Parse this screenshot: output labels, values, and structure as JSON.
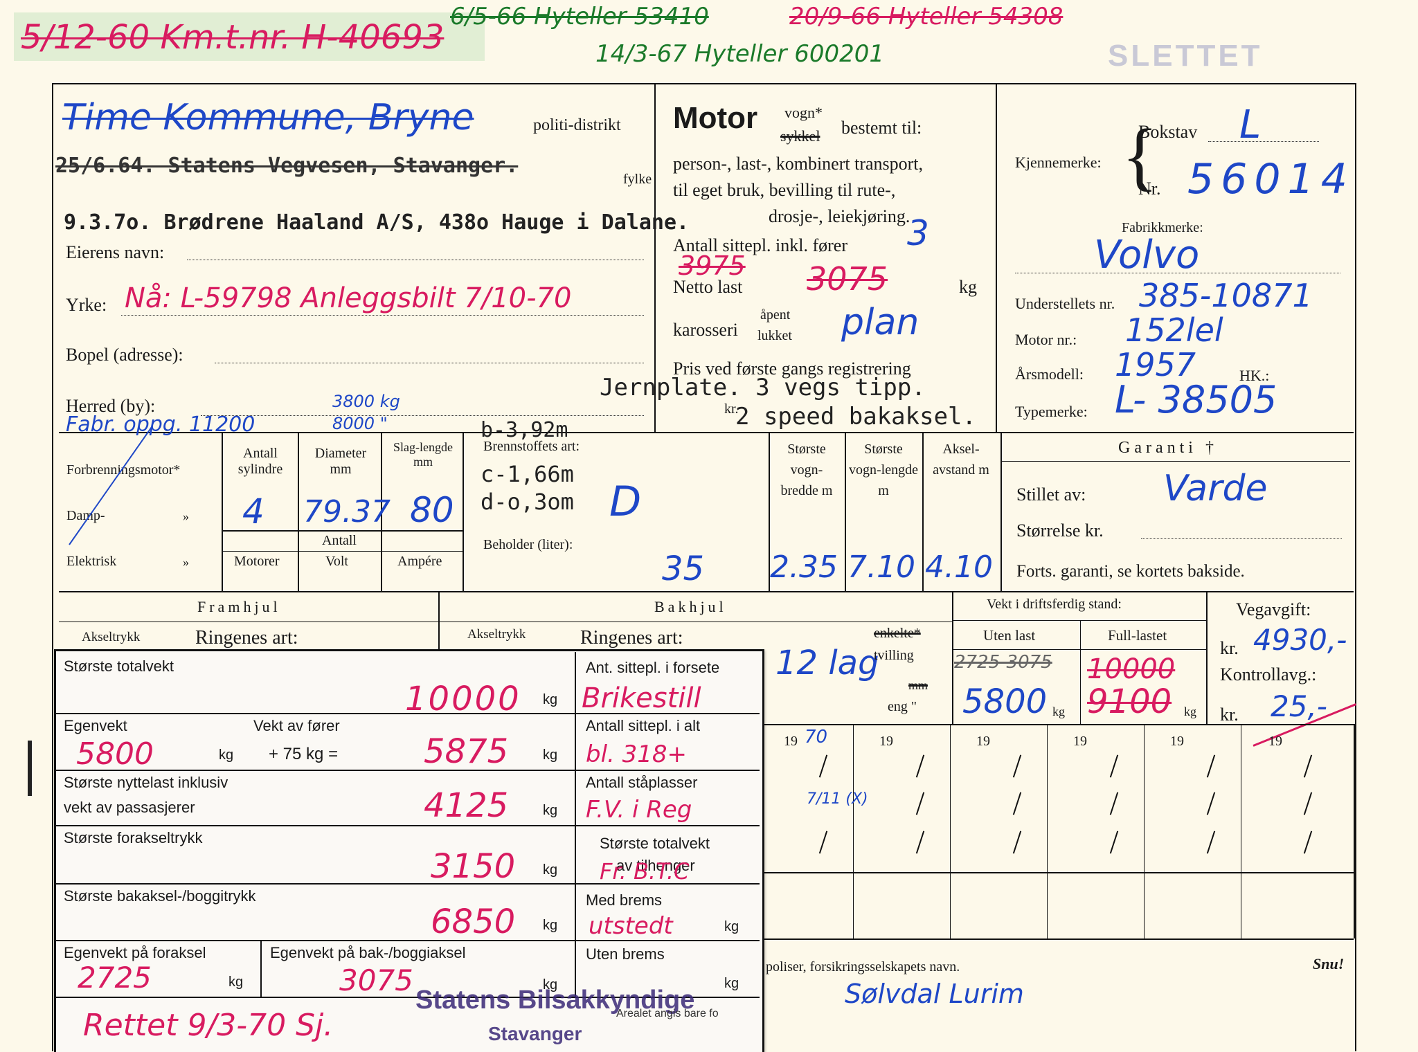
{
  "header": {
    "reg_line": "5/12-60 Km.t.nr. H-40693",
    "meter1": "6/5-66 Hyteller 53410",
    "meter2": "20/9-66 Hyteller 54308",
    "meter3": "14/3-67 Hyteller 600201",
    "stamp": "SLETTET"
  },
  "owner": {
    "district_label": "politi-distrikt",
    "struck_line1": "Time Kommune, Bryne",
    "struck_line2": "25/6.64. Statens Vegvesen, Stavanger.",
    "fylke_label": "fylke",
    "typed_owner": "9.3.7o. Brødrene Haaland A/S, 438o Hauge i Dalane.",
    "eier_label": "Eierens navn:",
    "yrke_label": "Yrke:",
    "yrke_value": "Nå: L-59798 Anleggsbilt 7/10-70",
    "bopel_label": "Bopel (adresse):",
    "herred_label": "Herred (by):",
    "fabr_note": "Fabr. oppg. 11200",
    "fabr_note2": "3800 kg",
    "fabr_note3": "8000 \""
  },
  "motor": {
    "title": "Motor",
    "vogn": "vogn*",
    "sykkel": "sykkel",
    "bestemt": "bestemt til:",
    "line1": "person-, last-, kombinert transport,",
    "line2": "til eget bruk, bevilling til rute-,",
    "line3": "drosje-, leiekjøring.",
    "sitteplasser_label": "Antall sittepl. inkl. fører",
    "sitteplasser_value": "3",
    "netto_label": "Netto last",
    "netto_struck": "3975",
    "netto_value": "3075",
    "kg": "kg",
    "karosseri_label": "karosseri",
    "apent": "åpent",
    "lukket": "lukket",
    "karosseri_value": "plan",
    "pris_label": "Pris ved første gangs registrering",
    "kr": "kr.",
    "typed_note1": "Jernplate. 3 vegs tipp.",
    "typed_note2": "2 speed bakaksel."
  },
  "ident": {
    "kjennemerke_label": "Kjennemerke:",
    "bokstav_label": "Bokstav",
    "bokstav_value": "L",
    "nr_label": "Nr.",
    "nr_value": "56014",
    "fabrikk_label": "Fabrikkmerke:",
    "fabrikk_value": "Volvo",
    "understell_label": "Understellets nr.",
    "understell_value": "385-10871",
    "motornr_label": "Motor nr.:",
    "motornr_value": "152lel",
    "arsmodell_label": "Årsmodell:",
    "arsmodell_value": "1957",
    "hk_label": "HK.:",
    "typemerke_label": "Typemerke:",
    "typemerke_value": "L- 38505"
  },
  "engine": {
    "forbrenning": "Forbrenningsmotor*",
    "damp": "Damp-",
    "elektrisk": "Elektrisk",
    "quote": "»",
    "sylindre_label": "Antall sylindre",
    "diameter_label": "Diameter mm",
    "slag_label": "Slag-lengde mm",
    "sylindre_value": "4",
    "diameter_value": "79.37",
    "slag_value": "80",
    "antall_label": "Antall",
    "motorer_label": "Motorer",
    "volt_label": "Volt",
    "ampere_label": "Ampére",
    "brennstoff_label": "Brennstoffets art:",
    "brennstoff_value": "D",
    "typed_b": "b-3,92m",
    "typed_c": "c-1,66m",
    "typed_d": "d-o,3om",
    "beholder_label": "Beholder (liter):",
    "beholder_value": "35"
  },
  "dims": {
    "bredde_label": "Største vogn-bredde m",
    "lengde_label": "Største vogn-lengde m",
    "aksel_label": "Aksel-avstand m",
    "bredde_value": "2.35",
    "lengde_value": "7.10",
    "aksel_value": "4.10"
  },
  "garanti": {
    "title": "Garanti †",
    "stillet_label": "Stillet av:",
    "stillet_value": "Varde",
    "storrelse_label": "Størrelse kr.",
    "forts": "Forts. garanti, se kortets bakside."
  },
  "wheels": {
    "framhjul": "Framhjul",
    "bakhjul": "Bakhjul",
    "akseltrykk1": "Akseltrykk",
    "ringenes1": "Ringenes art:",
    "akseltrykk2": "Akseltrykk",
    "ringenes2": "Ringenes art:",
    "lag_value": "12 lag",
    "enkelte": "enkelte*",
    "tvilling": "tvilling",
    "mm": "mm",
    "eng": "eng \""
  },
  "vekt": {
    "title": "Vekt i driftsferdig stand:",
    "uten_label": "Uten last",
    "full_label": "Full-lastet",
    "uten_struck": "2725-3075",
    "full_struck": "10000",
    "uten_value": "5800",
    "full_value": "9100",
    "kg": "kg"
  },
  "avgift": {
    "vegavgift_label": "Vegavgift:",
    "kr1": "kr.",
    "vegavgift_value": "4930,-",
    "kontroll_label": "Kontrollavg.:",
    "kr2": "kr.",
    "kontroll_value": "25,-"
  },
  "years": {
    "prefix": "19",
    "first_suffix": "70",
    "entry": "7/11 (X)"
  },
  "bottom": {
    "poliser": "poliser, forsikringsselskapets navn.",
    "forsikring_value": "Sølvdal Lurim",
    "snu": "Snu!"
  },
  "slip": {
    "totalvekt_label": "Største totalvekt",
    "totalvekt_value": "10000",
    "egenvekt_label": "Egenvekt",
    "egenvekt_value": "5800",
    "forer_label": "Vekt av fører",
    "plus75": "+ 75 kg =",
    "forer_value": "5875",
    "nyttelast_label1": "Største nyttelast inklusiv",
    "nyttelast_label2": "vekt av passasjerer",
    "nyttelast_value": "4125",
    "foraksel_label": "Største forakseltrykk",
    "foraksel_value": "3150",
    "bakaksel_label": "Største bakaksel-/boggitrykk",
    "bakaksel_value": "6850",
    "egen_for_label": "Egenvekt på foraksel",
    "egen_for_value": "2725",
    "egen_bak_label": "Egenvekt på bak-/boggiaksel",
    "egen_bak_value": "3075",
    "kg": "kg",
    "forsete_label": "Ant. sittepl. i forsete",
    "forsete_value": "Brikestill",
    "sittepl_alt_label": "Antall sittepl. i alt",
    "sittepl_alt_value": "bl. 318+",
    "staplasser_label": "Antall ståplasser",
    "staplasser_value": "F.V. i Reg",
    "tilhenger_label1": "Største totalvekt",
    "tilhenger_label2": "av tilhenger",
    "tilhenger_value": "Fr. B.T.C",
    "medbrems_label": "Med brems",
    "medbrems_value": "utstedt",
    "utenbrems_label": "Uten brems",
    "stamp1": "Statens Bilsakkyndige",
    "stamp2": "Stavanger",
    "small_note": "Arealet angis bare fo",
    "rettet": "Rettet 9/3-70 Sj."
  }
}
